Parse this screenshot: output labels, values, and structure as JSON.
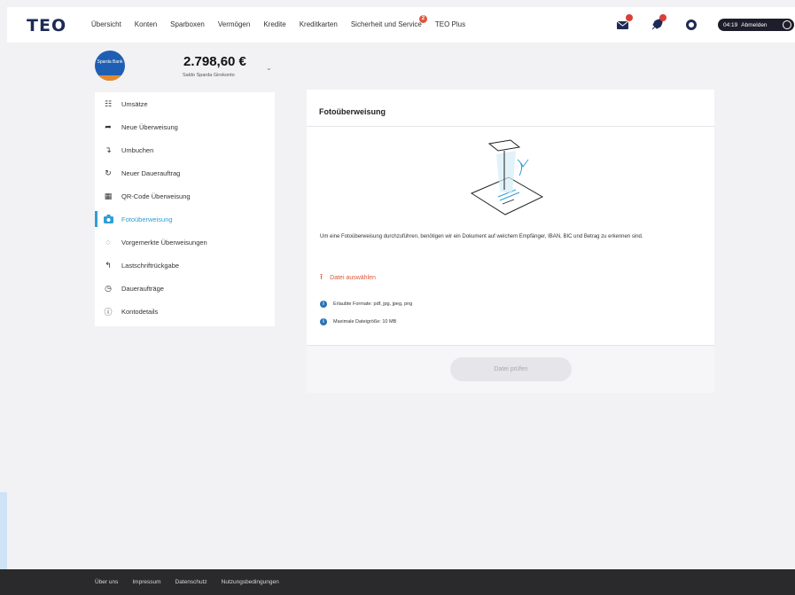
{
  "header": {
    "logo": "TEO",
    "nav": [
      {
        "label": "Übersicht"
      },
      {
        "label": "Konten",
        "active": true
      },
      {
        "label": "Sparboxen"
      },
      {
        "label": "Vermögen"
      },
      {
        "label": "Kredite"
      },
      {
        "label": "Kreditkarten"
      },
      {
        "label": "Sicherheit und Service",
        "badge": "2"
      },
      {
        "label": "TEO Plus"
      }
    ],
    "session_time": "04:19",
    "logout_label": "Abmelden"
  },
  "account": {
    "bank_logo_text": "Sparda Bank",
    "balance": "2.798,60 €",
    "subtitle": "Saldo Sparda Girokonto"
  },
  "sidebar": {
    "items": [
      {
        "label": "Umsätze",
        "icon": "list-icon"
      },
      {
        "label": "Neue Überweisung",
        "icon": "arrow-send-icon"
      },
      {
        "label": "Umbuchen",
        "icon": "transfer-icon"
      },
      {
        "label": "Neuer Dauerauftrag",
        "icon": "recurring-icon"
      },
      {
        "label": "QR-Code Überweisung",
        "icon": "qr-code-icon"
      },
      {
        "label": "Fotoüberweisung",
        "icon": "camera-icon",
        "active": true
      },
      {
        "label": "Vorgemerkte Überweisungen",
        "icon": "pending-icon"
      },
      {
        "label": "Lastschriftrückgabe",
        "icon": "return-arrow-icon"
      },
      {
        "label": "Daueraufträge",
        "icon": "clock-icon"
      },
      {
        "label": "Kontodetails",
        "icon": "info-circle-icon"
      }
    ]
  },
  "main": {
    "title": "Fotoüberweisung",
    "description": "Um eine Fotoüberweisung durchzuführen, benötigen wir ein Dokument auf welchem Empfänger, IBAN, BIC und Betrag zu erkennen sind.",
    "upload_label": "Datei auswählen",
    "info": [
      "Erlaubte Formate: pdf, jpg, jpeg, png",
      "Maximale Dateigröße: 10 MB"
    ],
    "check_button": "Datei prüfen"
  },
  "footer": {
    "links": [
      "Über uns",
      "Impressum",
      "Datenschutz",
      "Nutzungsbedingungen"
    ]
  },
  "colors": {
    "accent": "#2f9fd3",
    "brand": "#1e2a55",
    "upload": "#d9593c",
    "badge": "#d9403a"
  }
}
